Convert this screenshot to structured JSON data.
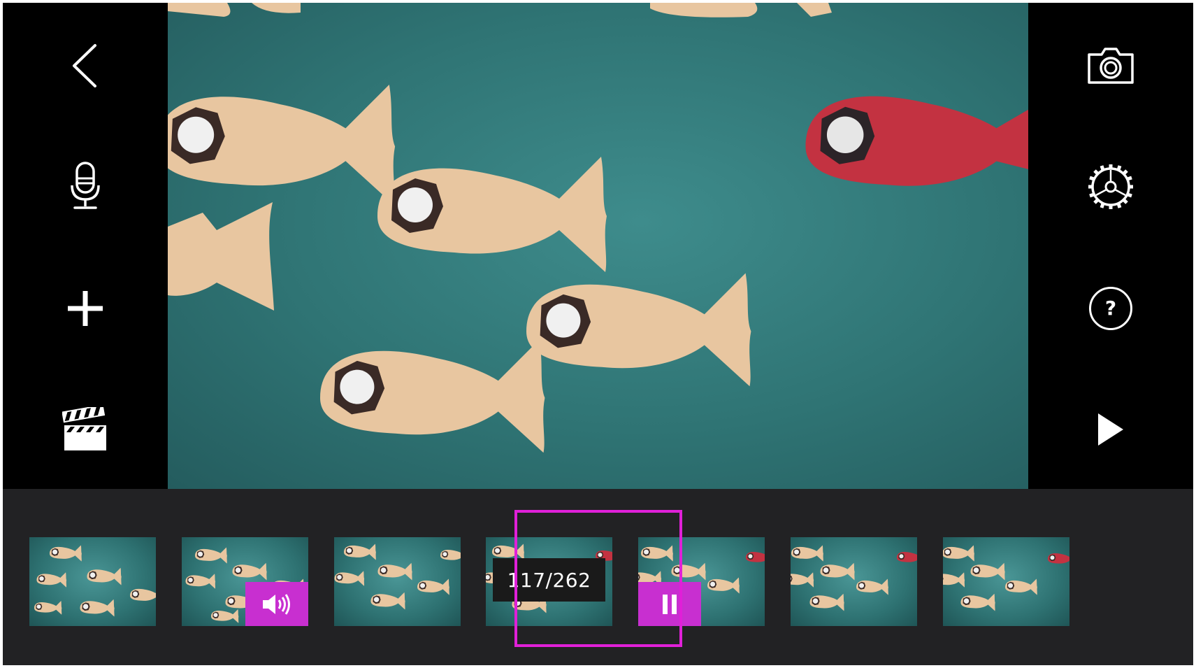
{
  "app": {
    "accent_color": "#e020d8",
    "badge_color": "#c82fd0"
  },
  "left_toolbar": {
    "items": [
      {
        "name": "back",
        "icon": "chevron-left-icon"
      },
      {
        "name": "record-audio",
        "icon": "microphone-icon"
      },
      {
        "name": "add-frame",
        "icon": "plus-icon"
      },
      {
        "name": "projects",
        "icon": "clapperboard-icon"
      }
    ]
  },
  "right_toolbar": {
    "items": [
      {
        "name": "capture",
        "icon": "camera-icon"
      },
      {
        "name": "settings",
        "icon": "gear-icon"
      },
      {
        "name": "help",
        "icon": "help-icon",
        "label": "?"
      },
      {
        "name": "play",
        "icon": "play-icon"
      }
    ]
  },
  "timeline": {
    "frame_counter": "117/262",
    "selected_index": 3,
    "frames": [
      {
        "badge": null
      },
      {
        "badge": "audio-icon"
      },
      {
        "badge": null
      },
      {
        "badge": null,
        "selected": true
      },
      {
        "badge": "pause-icon"
      },
      {
        "badge": null
      },
      {
        "badge": null
      }
    ]
  }
}
